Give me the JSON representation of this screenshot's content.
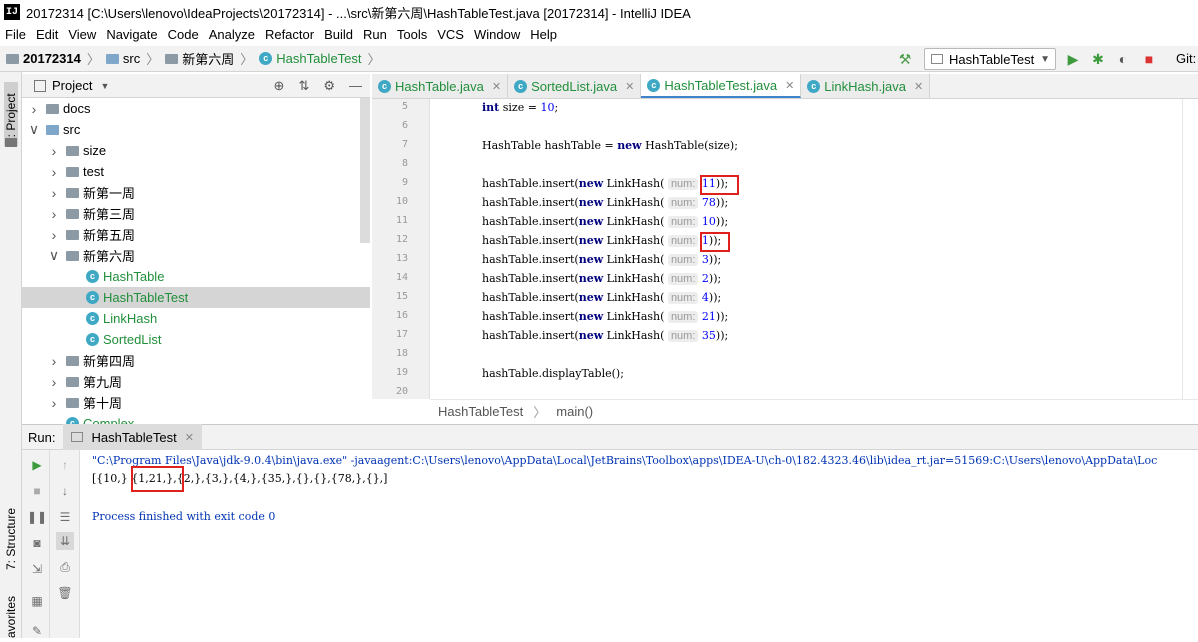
{
  "window": {
    "title": "20172314 [C:\\Users\\lenovo\\IdeaProjects\\20172314] - ...\\src\\新第六周\\HashTableTest.java [20172314] - IntelliJ IDEA",
    "icon_text": "IJ"
  },
  "menu": [
    "File",
    "Edit",
    "View",
    "Navigate",
    "Code",
    "Analyze",
    "Refactor",
    "Build",
    "Run",
    "Tools",
    "VCS",
    "Window",
    "Help"
  ],
  "breadcrumb": [
    {
      "label": "20172314"
    },
    {
      "label": "src"
    },
    {
      "label": "新第六周"
    },
    {
      "label": "HashTableTest"
    }
  ],
  "toolbar": {
    "run_config": "HashTableTest",
    "git_label": "Git:"
  },
  "side_strip": {
    "project": "1: Project",
    "structure": "7: Structure",
    "favorites": "avorites"
  },
  "project_panel": {
    "title": "Project",
    "tree": [
      {
        "label": "docs",
        "indent": 1,
        "arrow": "›",
        "icon": "folder"
      },
      {
        "label": "src",
        "indent": 1,
        "arrow": "⌄",
        "icon": "folder-blue"
      },
      {
        "label": "size",
        "indent": 2,
        "arrow": "›",
        "icon": "folder"
      },
      {
        "label": "test",
        "indent": 2,
        "arrow": "›",
        "icon": "folder"
      },
      {
        "label": "新第一周",
        "indent": 2,
        "arrow": "›",
        "icon": "folder"
      },
      {
        "label": "新第三周",
        "indent": 2,
        "arrow": "›",
        "icon": "folder"
      },
      {
        "label": "新第五周",
        "indent": 2,
        "arrow": "›",
        "icon": "folder"
      },
      {
        "label": "新第六周",
        "indent": 2,
        "arrow": "⌄",
        "icon": "folder"
      },
      {
        "label": "HashTable",
        "indent": 3,
        "arrow": "",
        "icon": "class"
      },
      {
        "label": "HashTableTest",
        "indent": 3,
        "arrow": "",
        "icon": "class",
        "selected": true
      },
      {
        "label": "LinkHash",
        "indent": 3,
        "arrow": "",
        "icon": "class"
      },
      {
        "label": "SortedList",
        "indent": 3,
        "arrow": "",
        "icon": "class"
      },
      {
        "label": "新第四周",
        "indent": 2,
        "arrow": "›",
        "icon": "folder"
      },
      {
        "label": "第九周",
        "indent": 2,
        "arrow": "›",
        "icon": "folder"
      },
      {
        "label": "第十周",
        "indent": 2,
        "arrow": "›",
        "icon": "folder"
      },
      {
        "label": "Complex",
        "indent": 2,
        "arrow": "",
        "icon": "class"
      }
    ]
  },
  "editor_tabs": [
    {
      "label": "HashTable.java",
      "active": false
    },
    {
      "label": "SortedList.java",
      "active": false
    },
    {
      "label": "HashTableTest.java",
      "active": true
    },
    {
      "label": "LinkHash.java",
      "active": false
    }
  ],
  "code_lines": [
    {
      "n": "5",
      "html": "<span class=\"kw\">int</span> size = <span class=\"num\">10</span>;"
    },
    {
      "n": "6",
      "html": ""
    },
    {
      "n": "7",
      "html": "HashTable hashTable = <span class=\"kw\">new</span> HashTable(size);"
    },
    {
      "n": "8",
      "html": ""
    },
    {
      "n": "9",
      "html": "hashTable.insert(<span class=\"kw\">new</span> LinkHash( <span class=\"hint\">num:</span> <span class=\"num\">11</span>));"
    },
    {
      "n": "10",
      "html": "hashTable.insert(<span class=\"kw\">new</span> LinkHash( <span class=\"hint\">num:</span> <span class=\"num\">78</span>));"
    },
    {
      "n": "11",
      "html": "hashTable.insert(<span class=\"kw\">new</span> LinkHash( <span class=\"hint\">num:</span> <span class=\"num\">10</span>));"
    },
    {
      "n": "12",
      "html": "hashTable.insert(<span class=\"kw\">new</span> LinkHash( <span class=\"hint\">num:</span> <span class=\"num\">1</span>));"
    },
    {
      "n": "13",
      "html": "hashTable.insert(<span class=\"kw\">new</span> LinkHash( <span class=\"hint\">num:</span> <span class=\"num\">3</span>));"
    },
    {
      "n": "14",
      "html": "hashTable.insert(<span class=\"kw\">new</span> LinkHash( <span class=\"hint\">num:</span> <span class=\"num\">2</span>));"
    },
    {
      "n": "15",
      "html": "hashTable.insert(<span class=\"kw\">new</span> LinkHash( <span class=\"hint\">num:</span> <span class=\"num\">4</span>));"
    },
    {
      "n": "16",
      "html": "hashTable.insert(<span class=\"kw\">new</span> LinkHash( <span class=\"hint\">num:</span> <span class=\"num\">21</span>));"
    },
    {
      "n": "17",
      "html": "hashTable.insert(<span class=\"kw\">new</span> LinkHash( <span class=\"hint\">num:</span> <span class=\"num\">35</span>));"
    },
    {
      "n": "18",
      "html": ""
    },
    {
      "n": "19",
      "html": "hashTable.displayTable();"
    },
    {
      "n": "20",
      "html": ""
    }
  ],
  "editor_breadcrumb": {
    "file": "HashTableTest",
    "method": "main()"
  },
  "run_panel": {
    "label": "Run:",
    "tab": "HashTableTest",
    "console": [
      "\"C:\\Program Files\\Java\\jdk-9.0.4\\bin\\java.exe\" -javaagent:C:\\Users\\lenovo\\AppData\\Local\\JetBrains\\Toolbox\\apps\\IDEA-U\\ch-0\\182.4323.46\\lib\\idea_rt.jar=51569:C:\\Users\\lenovo\\AppData\\Loc",
      "[{10,} {1,21,},{2,},{3,},{4,},{35,},{},{},{78,},{},]",
      "",
      "Process finished with exit code 0"
    ]
  },
  "colors": {
    "console_text": "#0033b3",
    "highlight_box": "#e0201c",
    "class_tab": "#218f3b"
  }
}
